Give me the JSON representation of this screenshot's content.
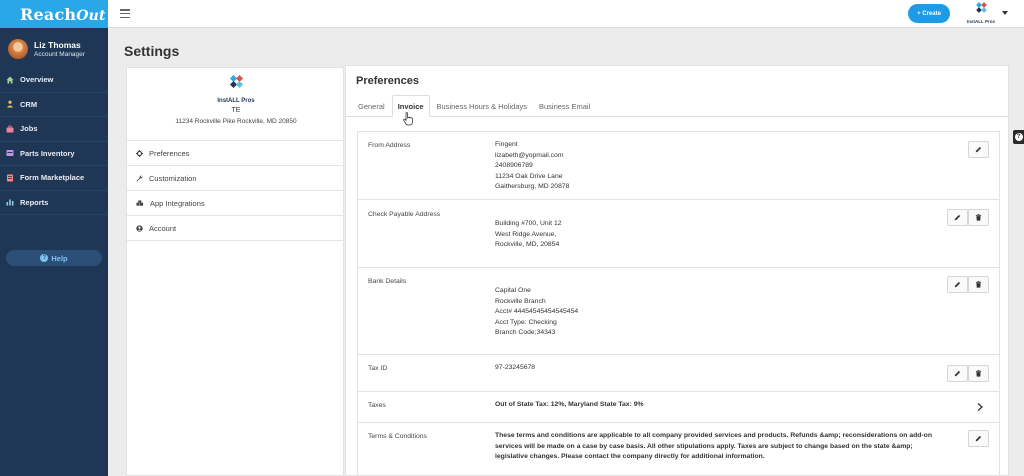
{
  "app": {
    "brand": "Reach",
    "brand_suffix": "Out",
    "brand_color": "#2aa7e6",
    "sidebar_color": "#1f3654"
  },
  "user": {
    "name": "Liz Thomas",
    "role": "Account Manager"
  },
  "nav": [
    {
      "label": "Overview",
      "icon": "home-icon"
    },
    {
      "label": "CRM",
      "icon": "crm-icon"
    },
    {
      "label": "Jobs",
      "icon": "briefcase-icon"
    },
    {
      "label": "Parts Inventory",
      "icon": "inventory-icon"
    },
    {
      "label": "Form Marketplace",
      "icon": "form-icon"
    },
    {
      "label": "Reports",
      "icon": "bar-chart-icon"
    }
  ],
  "help_label": "Help",
  "topbar": {
    "create_label": "+ Create",
    "company_logo_text": "InstALL Pros"
  },
  "page": {
    "title": "Settings"
  },
  "company": {
    "name": "TE",
    "address": "11234 Rockville Pike Rockville, MD 20850",
    "logo_text": "InstALL Pros"
  },
  "settings_menu": [
    {
      "label": "Preferences",
      "icon": "gear-icon"
    },
    {
      "label": "Customization",
      "icon": "wrench-icon"
    },
    {
      "label": "App Integrations",
      "icon": "puzzle-icon"
    },
    {
      "label": "Account",
      "icon": "user-circle-icon"
    }
  ],
  "preferences": {
    "title": "Preferences",
    "tabs": [
      "General",
      "Invoice",
      "Business Hours & Holidays",
      "Business Email"
    ],
    "active_tab": "Invoice"
  },
  "invoice_rows": {
    "from_address": {
      "label": "From Address",
      "lines": [
        "Fingent",
        "lizabeth@yopmail.com",
        "2408906789",
        "11234 Oak Drive Lane",
        "Gaithersburg, MD 20878"
      ]
    },
    "check_payable": {
      "label": "Check Payable Address",
      "lines": [
        "Building #700, Unit 12",
        "West Ridge Avenue,",
        "Rockville, MD, 20854"
      ]
    },
    "bank_details": {
      "label": "Bank Details",
      "lines": [
        "Capital One",
        "Rockville Branch",
        "Acct# 44454545454545454",
        "Acct Type: Checking",
        "Branch Code;34343"
      ]
    },
    "tax_id": {
      "label": "Tax ID",
      "value": "97-23245678"
    },
    "taxes": {
      "label": "Taxes",
      "value": "Out of State Tax: 12%, Maryland State Tax: 9%"
    },
    "terms": {
      "label": "Terms & Conditions",
      "value": "These terms and conditions are applicable to all company provided services and products. Refunds &amp; reconsiderations on add-on services will be made on a case by case basis. All other stipulations apply. Taxes are subject to change based on the state &amp; legislative changes. Please contact the company directly for additional information."
    }
  }
}
